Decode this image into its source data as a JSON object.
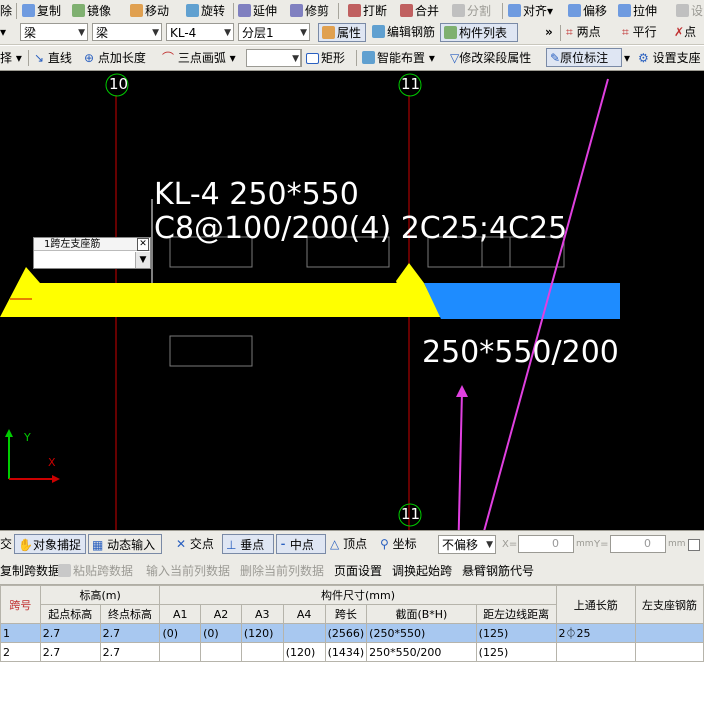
{
  "toolbar1": {
    "items": [
      "除",
      "复制",
      "镜像",
      "移动",
      "旋转",
      "延伸",
      "修剪",
      "打断",
      "合并",
      "分割",
      "对齐",
      "偏移",
      "拉伸",
      "设"
    ]
  },
  "toolbar2": {
    "combo1": "梁",
    "combo2": "梁",
    "combo3": "KL-4",
    "combo4": "分层1",
    "attr": "属性",
    "edit_rebar": "编辑钢筋",
    "member_list": "构件列表",
    "two_point": "两点",
    "parallel": "平行",
    "point": "点"
  },
  "toolbar3": {
    "select": "择",
    "line": "直线",
    "point_len": "点加长度",
    "arc3": "三点画弧",
    "rect": "矩形",
    "smart_place": "智能布置",
    "modify_span": "修改梁段属性",
    "orig_label": "原位标注",
    "set_support": "设置支座"
  },
  "canvas": {
    "axis_10": "10",
    "axis_11_top": "11",
    "axis_11_bottom": "11",
    "beam_text_1": "KL-4 250*550",
    "beam_text_2": "C8@100/200(4) 2C25;4C25",
    "section_label": "250*550/200",
    "popup_title": "1跨左支座筋",
    "popup_close": "✕",
    "ucs_y": "Y",
    "ucs_x": "X",
    "colors": {
      "beam_yellow": "#ffff00",
      "beam_blue": "#1e8cff",
      "axis_red": "#cc0000",
      "circle_green": "#00cc00",
      "arrow_magenta": "#e040e0"
    }
  },
  "statusbar": {
    "intersect": "交",
    "obj_snap": "对象捕捉",
    "dyn_input": "动态输入",
    "cross_point": "交点",
    "perp": "垂点",
    "mid": "中点",
    "vertex": "顶点",
    "coord": "坐标",
    "no_offset": "不偏移",
    "x_label": "X=",
    "x_value": "0",
    "y_label": "Y=",
    "y_value": "0",
    "mm1": "mm",
    "mm2": "mm"
  },
  "toolbar4": {
    "copy_span": "复制跨数据",
    "paste_span": "粘贴跨数据",
    "input_col": "输入当前列数据",
    "delete_col": "删除当前列数据",
    "page_setup": "页面设置",
    "swap_span": "调换起始跨",
    "cantilever": "悬臂钢筋代号"
  },
  "grid": {
    "h_span": "跨号",
    "h_elev": "标高(m)",
    "h_size": "构件尺寸(mm)",
    "h_top": "上通长筋",
    "h_left": "左支座钢筋",
    "h_start": "起点标高",
    "h_end": "终点标高",
    "h_a1": "A1",
    "h_a2": "A2",
    "h_a3": "A3",
    "h_a4": "A4",
    "h_len": "跨长",
    "h_sec": "截面(B*H)",
    "h_dist": "距左边线距离",
    "rows": [
      [
        "1",
        "2.7",
        "2.7",
        "(0)",
        "(0)",
        "(120)",
        "",
        "(2566)",
        "(250*550)",
        "(125)",
        "2⏀25",
        ""
      ],
      [
        "2",
        "2.7",
        "2.7",
        "",
        "",
        "",
        "(120)",
        "(1434)",
        "250*550/200",
        "(125)",
        "",
        ""
      ]
    ]
  }
}
